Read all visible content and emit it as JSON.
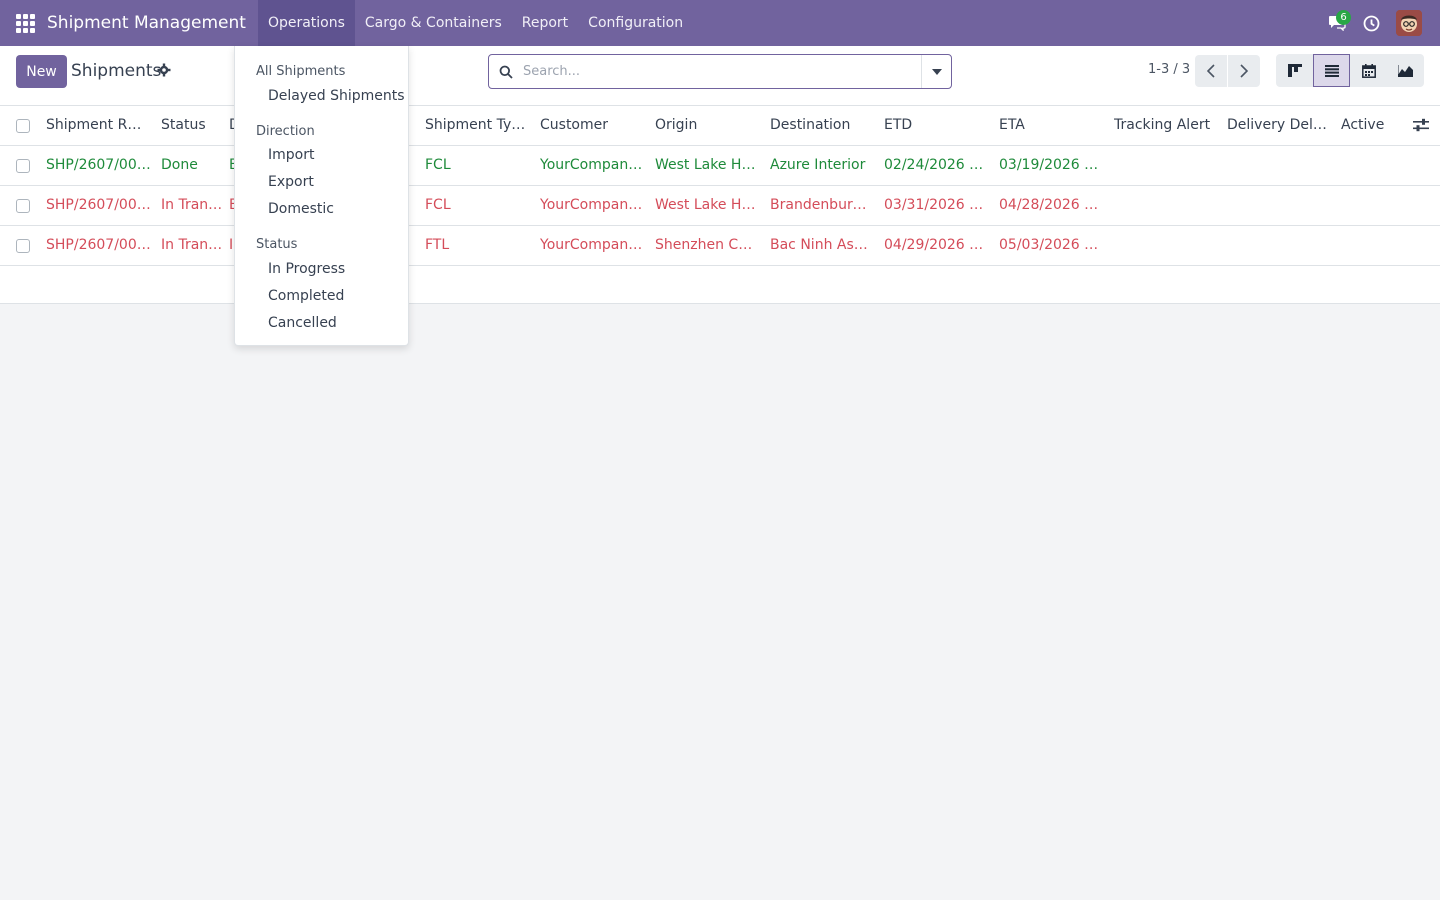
{
  "navbar": {
    "brand": "Shipment Management",
    "menus": [
      "Operations",
      "Cargo & Containers",
      "Report",
      "Configuration"
    ],
    "active_menu": "Operations",
    "messages_badge": "6"
  },
  "control_panel": {
    "new_label": "New",
    "title": "Shipments",
    "search_placeholder": "Search...",
    "pager": "1-3 / 3"
  },
  "table": {
    "columns": [
      "Shipment R…",
      "Status",
      "D",
      "Shipment Ty…",
      "Customer",
      "Origin",
      "Destination",
      "ETD",
      "ETA",
      "Tracking Alert",
      "Delivery Del…",
      "Active"
    ],
    "rows": [
      {
        "ref": "SHP/2607/000…",
        "status": "Done",
        "d": "E",
        "type": "FCL",
        "customer": "YourCompany,…",
        "origin": "West Lake Hu…",
        "destination": "Azure Interior",
        "etd": "02/24/2026 1…",
        "eta": "03/19/2026 0…",
        "color": "#1e8a3a"
      },
      {
        "ref": "SHP/2607/000…",
        "status": "In Transit",
        "d": "E",
        "type": "FCL",
        "customer": "YourCompany,…",
        "origin": "West Lake Hu…",
        "destination": "Brandenburge…",
        "etd": "03/31/2026 1…",
        "eta": "04/28/2026 0…",
        "color": "#d44c59"
      },
      {
        "ref": "SHP/2607/000…",
        "status": "In Transit",
        "d": "I",
        "type": "FTL",
        "customer": "YourCompany,…",
        "origin": "Shenzhen Co…",
        "destination": "Bac Ninh Asse…",
        "etd": "04/29/2026 0…",
        "eta": "05/03/2026 1…",
        "color": "#d44c59"
      }
    ]
  },
  "dropdown": {
    "all_shipments": "All Shipments",
    "delayed": "Delayed Shipments",
    "direction_header": "Direction",
    "import": "Import",
    "export": "Export",
    "domestic": "Domestic",
    "status_header": "Status",
    "in_progress": "In Progress",
    "completed": "Completed",
    "cancelled": "Cancelled"
  },
  "colors": {
    "primary": "#71639e",
    "done_green": "#1e8a3a",
    "transit_red": "#d44c59"
  },
  "icons": [
    "apps-grid-icon",
    "chat-icon",
    "clock-icon",
    "avatar",
    "gear-icon",
    "search-icon",
    "caret-down-icon",
    "chevron-left-icon",
    "chevron-right-icon",
    "kanban-view-icon",
    "list-view-icon",
    "calendar-view-icon",
    "graph-view-icon",
    "column-settings-icon"
  ]
}
